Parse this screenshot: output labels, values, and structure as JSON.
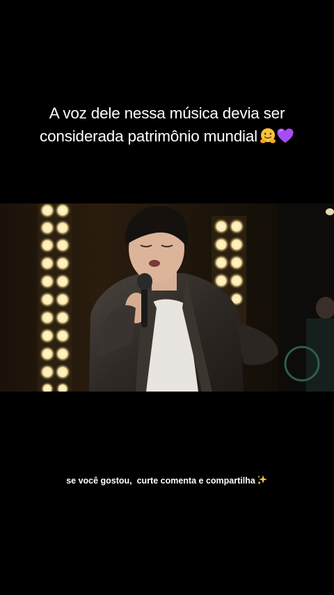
{
  "overlay_caption": {
    "line1": "A voz dele nessa música devia ser",
    "line2": "considerada patrimônio mundial",
    "emoji_1": "smiling-face-with-hugging-hands-icon",
    "emoji_2": "purple-heart-icon"
  },
  "video": {
    "description_icon": "singer-on-stage-image"
  },
  "bottom_caption": {
    "text": "se você gostou,  curte comenta e compartilha",
    "emoji": "sparkles-icon"
  },
  "colors": {
    "background": "#000000",
    "text": "#ffffff",
    "stage_light": "#fff3c9",
    "heart": "#a64df5",
    "face": "#f8c23a"
  }
}
